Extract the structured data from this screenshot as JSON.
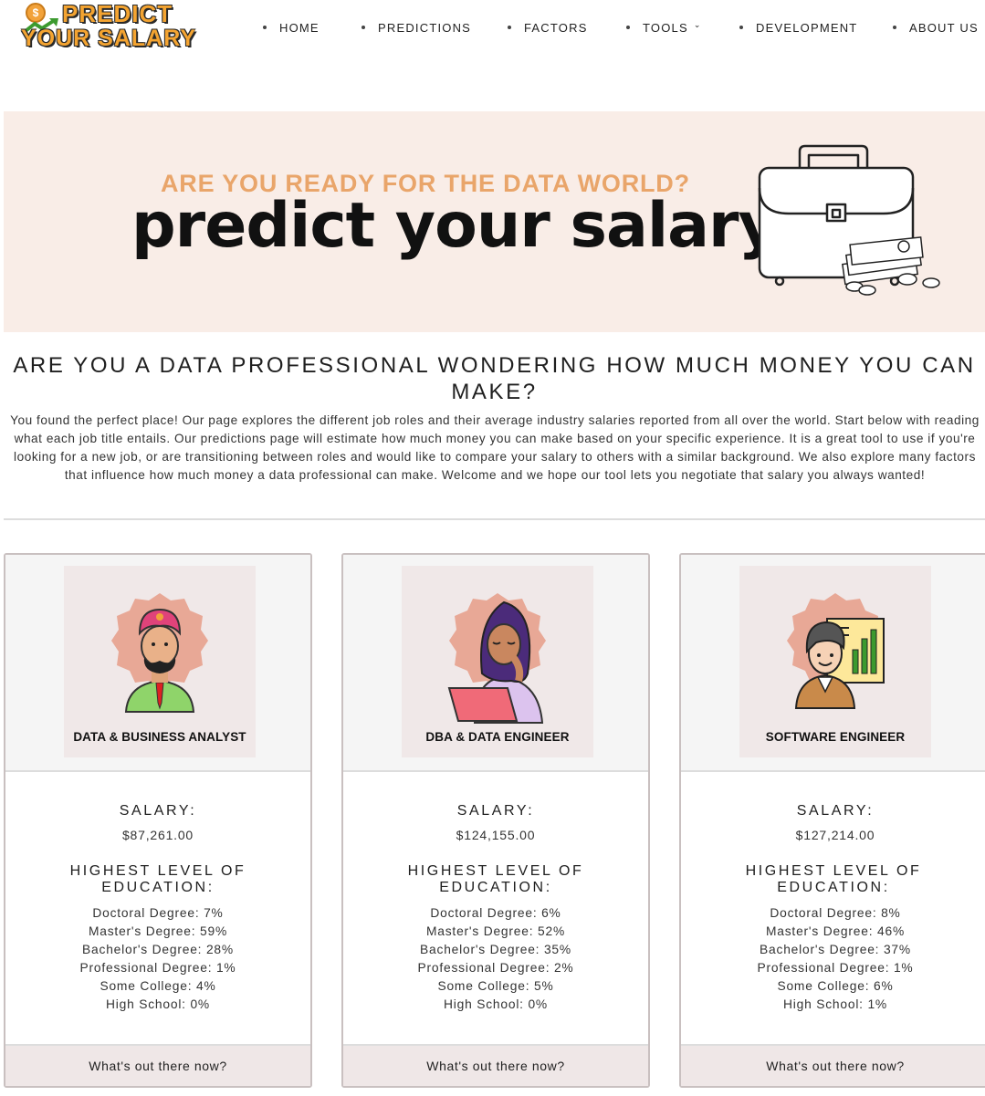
{
  "brand": {
    "line1": "PREDICT",
    "line2": "YOUR SALARY",
    "coin_symbol": "$"
  },
  "nav": {
    "home": "HOME",
    "predictions": "PREDICTIONS",
    "factors": "FACTORS",
    "tools": "TOOLS",
    "development": "DEVELOPMENT",
    "about": "ABOUT US"
  },
  "banner": {
    "subtitle": "ARE YOU READY FOR THE DATA WORLD?",
    "title": "predict your salary"
  },
  "intro": {
    "heading": "ARE YOU A DATA PROFESSIONAL WONDERING HOW MUCH MONEY YOU CAN MAKE?",
    "body": "You found the perfect place! Our page explores the different job roles and their average industry salaries reported from all over the world. Start below with reading what each job title entails. Our predictions page will estimate how much money you can make based on your specific experience. It is a great tool to use if you're looking for a new job, or are transitioning between roles and would like to compare your salary to others with a similar background. We also explore many factors that influence how much money a data professional can make. Welcome and we hope our tool lets you negotiate that salary you always wanted!"
  },
  "cards": [
    {
      "role": "DATA & BUSINESS ANALYST",
      "salary_label": "SALARY:",
      "salary": "$87,261.00",
      "education_label": "HIGHEST LEVEL OF EDUCATION:",
      "education": [
        "Doctoral Degree: 7%",
        "Master's Degree: 59%",
        "Bachelor's Degree: 28%",
        "Professional Degree: 1%",
        "Some College: 4%",
        "High School: 0%"
      ],
      "button": "What's out there now?"
    },
    {
      "role": "DBA & DATA ENGINEER",
      "salary_label": "SALARY:",
      "salary": "$124,155.00",
      "education_label": "HIGHEST LEVEL OF EDUCATION:",
      "education": [
        "Doctoral Degree: 6%",
        "Master's Degree: 52%",
        "Bachelor's Degree: 35%",
        "Professional Degree: 2%",
        "Some College: 5%",
        "High School: 0%"
      ],
      "button": "What's out there now?"
    },
    {
      "role": "SOFTWARE ENGINEER",
      "salary_label": "SALARY:",
      "salary": "$127,214.00",
      "education_label": "HIGHEST LEVEL OF EDUCATION:",
      "education": [
        "Doctoral Degree: 8%",
        "Master's Degree: 46%",
        "Bachelor's Degree: 37%",
        "Professional Degree: 1%",
        "Some College: 6%",
        "High School: 1%"
      ],
      "button": "What's out there now?"
    }
  ],
  "colors": {
    "accent_orange": "#f4a431",
    "banner_bg": "#f9ede7",
    "badge_peach": "#e8a896",
    "card_footer": "#efe7e7"
  }
}
